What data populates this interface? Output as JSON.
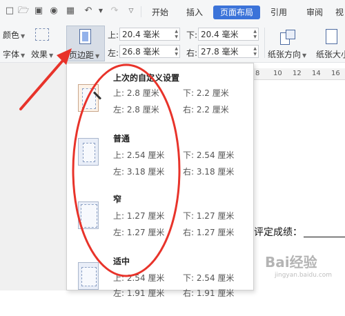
{
  "tabs": [
    "开始",
    "插入",
    "页面布局",
    "引用",
    "审阅",
    "视"
  ],
  "ribbon": {
    "color_label": "颜色",
    "font_label": "字体",
    "effect_label": "效果",
    "margin_button_label": "页边距",
    "top_label": "上:",
    "top_value": "20.4 毫米",
    "bottom_label": "下:",
    "bottom_value": "20.4 毫米",
    "left_label": "左:",
    "left_value": "26.8 毫米",
    "right_label": "右:",
    "right_value": "27.8 毫米",
    "orientation_label": "纸张方向",
    "size_label": "纸张大小"
  },
  "ruler": {
    "numbers": [
      "8",
      "10",
      "12",
      "14",
      "16"
    ]
  },
  "presets": [
    {
      "title": "上次的自定义设置",
      "top": "上: 2.8 厘米",
      "bottom": "下: 2.2 厘米",
      "left": "左: 2.8 厘米",
      "right": "右: 2.2 厘米"
    },
    {
      "title": "普通",
      "top": "上: 2.54 厘米",
      "bottom": "下: 2.54 厘米",
      "left": "左: 3.18 厘米",
      "right": "右: 3.18 厘米"
    },
    {
      "title": "窄",
      "top": "上: 1.27 厘米",
      "bottom": "下: 1.27 厘米",
      "left": "左: 1.27 厘米",
      "right": "右: 1.27 厘米"
    },
    {
      "title": "适中",
      "top": "上: 2.54 厘米",
      "bottom": "下: 2.54 厘米",
      "left": "左: 1.91 厘米",
      "right": "右: 1.91 厘米"
    }
  ],
  "document": {
    "grade_text": "评定成绩："
  },
  "watermark": {
    "text": "Bai经验",
    "sub": "jingyan.baidu.com"
  },
  "colors": {
    "accent": "#3b73d9",
    "annotation": "#e8332a"
  }
}
